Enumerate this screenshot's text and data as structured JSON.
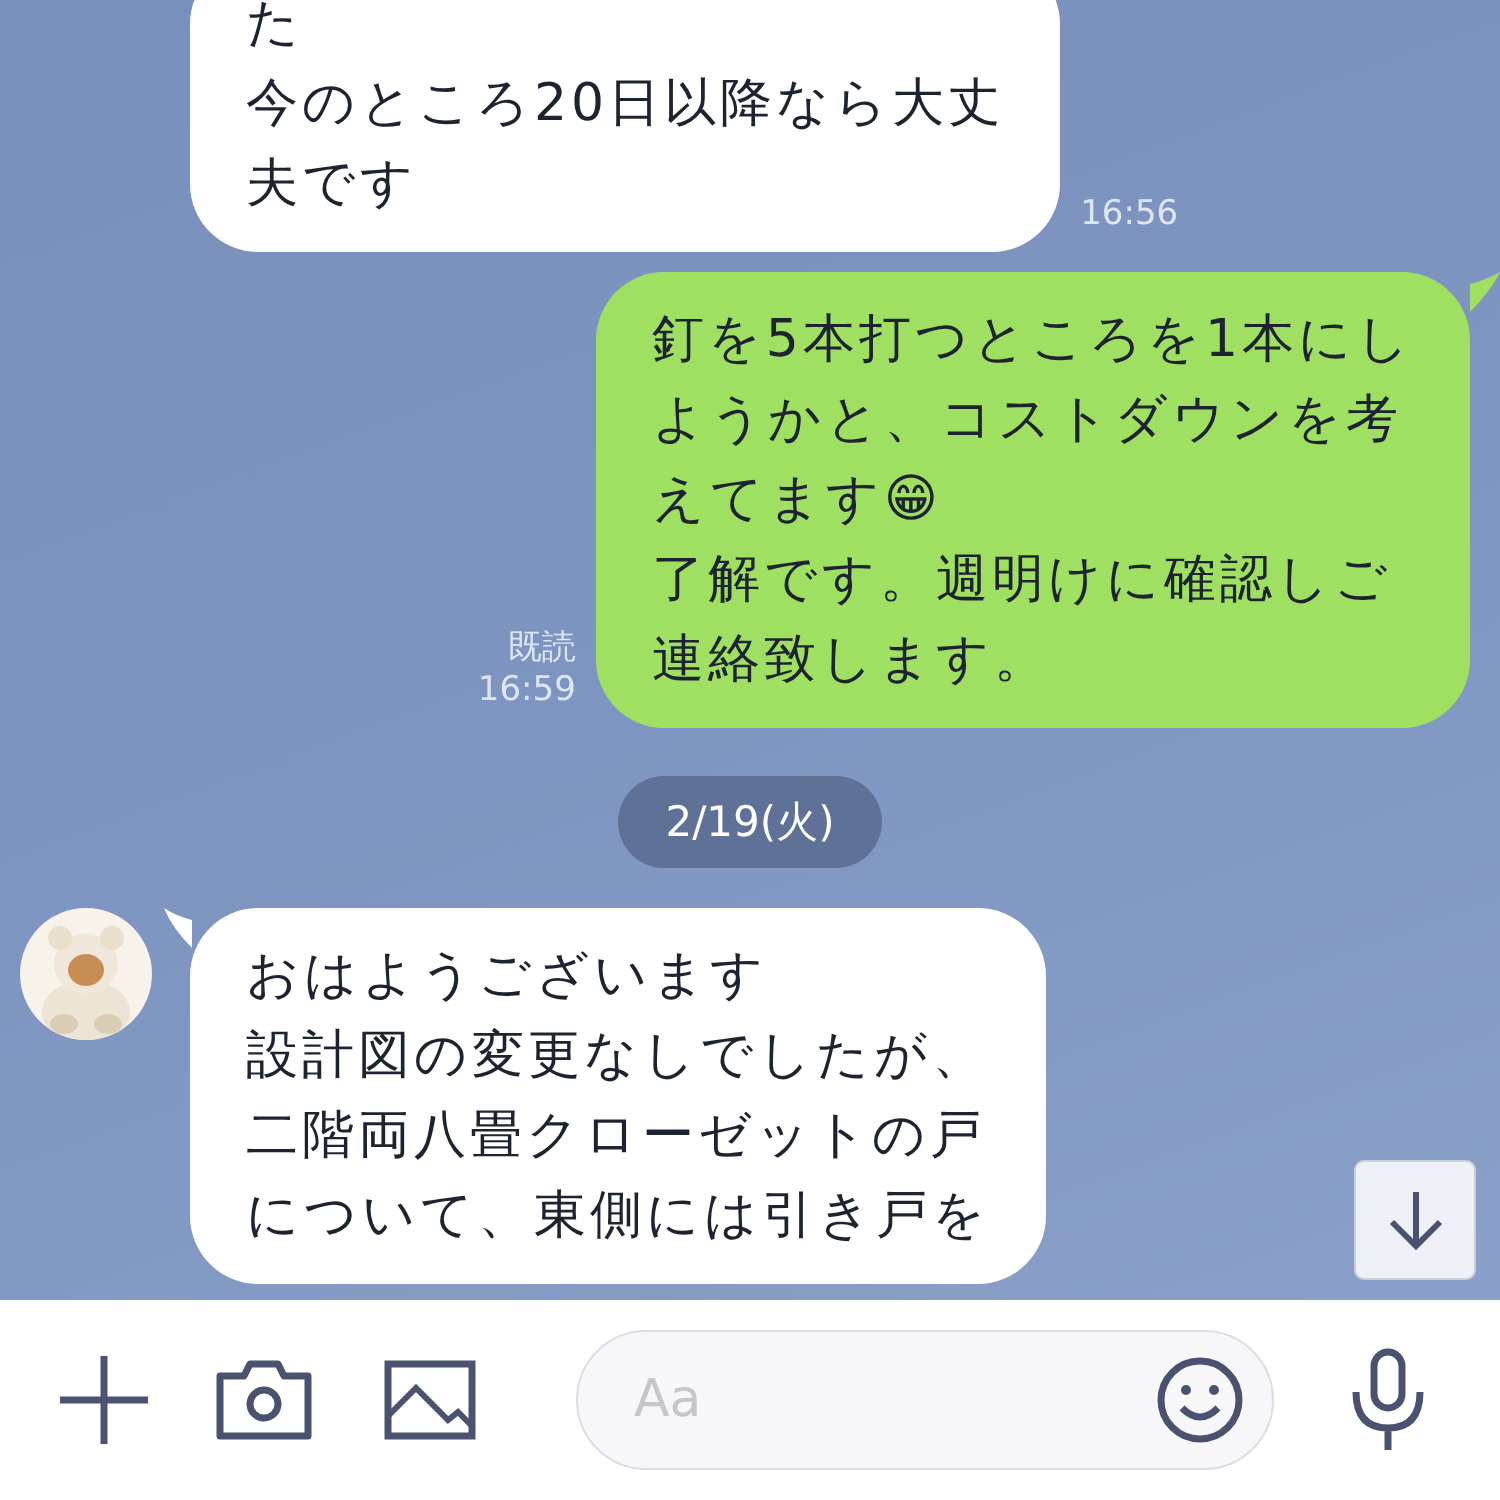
{
  "messages": [
    {
      "kind": "incoming",
      "avatar": false,
      "lines": [
        "た",
        "今のところ20日以降なら大丈",
        "夫です"
      ],
      "time": "16:56"
    },
    {
      "kind": "outgoing",
      "lines": [
        "釘を5本打つところを1本にし",
        "ようかと、コストダウンを考",
        "えてます😁",
        "了解です。週明けに確認しご",
        "連絡致します。"
      ],
      "read": "既読",
      "time": "16:59"
    },
    {
      "kind": "date",
      "label": "2/19(火)"
    },
    {
      "kind": "incoming",
      "avatar": true,
      "lines": [
        "おはようございます",
        "設計図の変更なしでしたが、",
        "二階両八畳クローゼットの戸",
        "について、東側には引き戸を"
      ]
    }
  ],
  "input": {
    "placeholder": "Aa"
  }
}
